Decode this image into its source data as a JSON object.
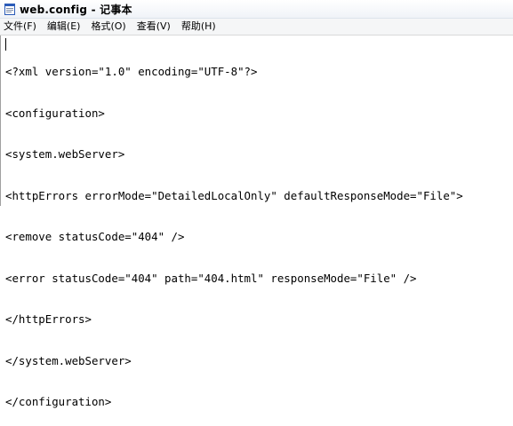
{
  "window": {
    "title": "web.config - 记事本"
  },
  "menu": {
    "items": [
      {
        "label": "文件(F)"
      },
      {
        "label": "编辑(E)"
      },
      {
        "label": "格式(O)"
      },
      {
        "label": "查看(V)"
      },
      {
        "label": "帮助(H)"
      }
    ]
  },
  "editor": {
    "lines": [
      "<?xml version=\"1.0\" encoding=\"UTF-8\"?>",
      "<configuration>",
      "<system.webServer>",
      "<httpErrors errorMode=\"DetailedLocalOnly\" defaultResponseMode=\"File\">",
      "<remove statusCode=\"404\" />",
      "<error statusCode=\"404\" path=\"404.html\" responseMode=\"File\" />",
      "</httpErrors>",
      "</system.webServer>",
      "</configuration>"
    ]
  },
  "colors": {
    "app_icon_blue": "#2a5bb8",
    "text": "#000000",
    "background": "#ffffff"
  },
  "icons": {
    "app": "notepad-icon"
  }
}
